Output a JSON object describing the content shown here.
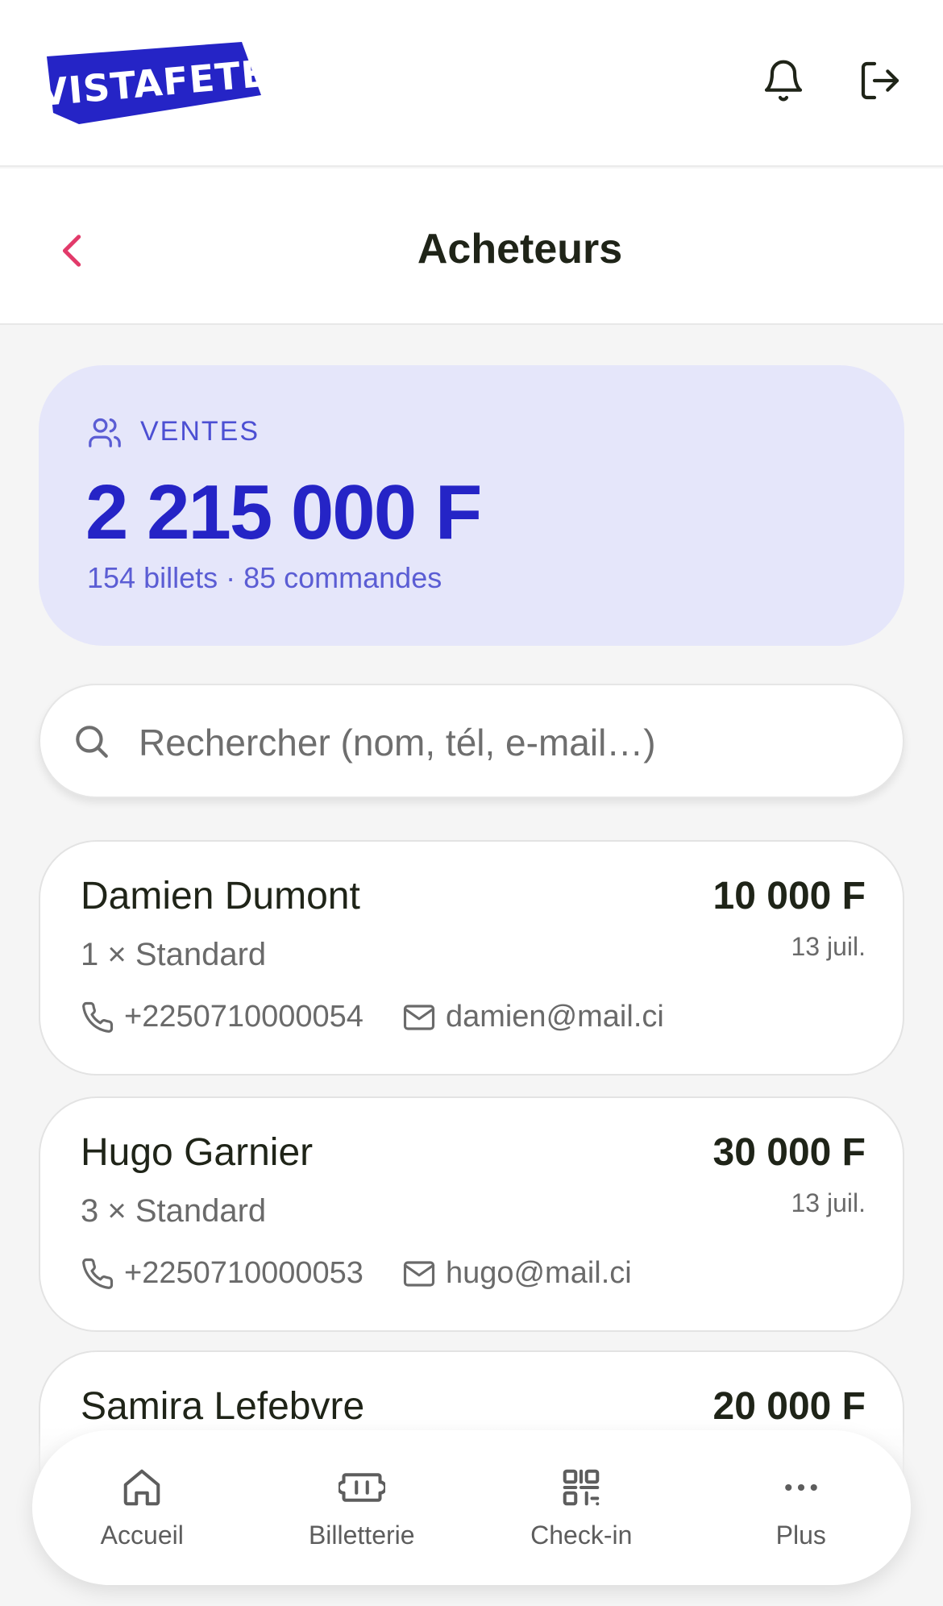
{
  "app": {
    "logo_text": "VISTAFETE",
    "brand_color": "#2524c6",
    "accent_color": "#e23a6a"
  },
  "header": {
    "title": "Acheteurs"
  },
  "summary": {
    "label": "VENTES",
    "amount": "2 215 000 F",
    "subtitle": "154 billets · 85 commandes"
  },
  "search": {
    "placeholder": "Rechercher (nom, tél, e-mail…)"
  },
  "buyers": [
    {
      "name": "Damien Dumont",
      "tickets": "1 × Standard",
      "amount": "10 000 F",
      "date": "13 juil.",
      "phone": "+2250710000054",
      "email": "damien@mail.ci"
    },
    {
      "name": "Hugo Garnier",
      "tickets": "3 × Standard",
      "amount": "30 000 F",
      "date": "13 juil.",
      "phone": "+2250710000053",
      "email": "hugo@mail.ci"
    },
    {
      "name": "Samira Lefebvre",
      "amount": "20 000 F"
    }
  ],
  "nav": {
    "items": [
      {
        "label": "Accueil",
        "icon": "home-icon"
      },
      {
        "label": "Billetterie",
        "icon": "ticket-icon"
      },
      {
        "label": "Check-in",
        "icon": "qr-code-icon"
      },
      {
        "label": "Plus",
        "icon": "more-icon"
      }
    ]
  }
}
